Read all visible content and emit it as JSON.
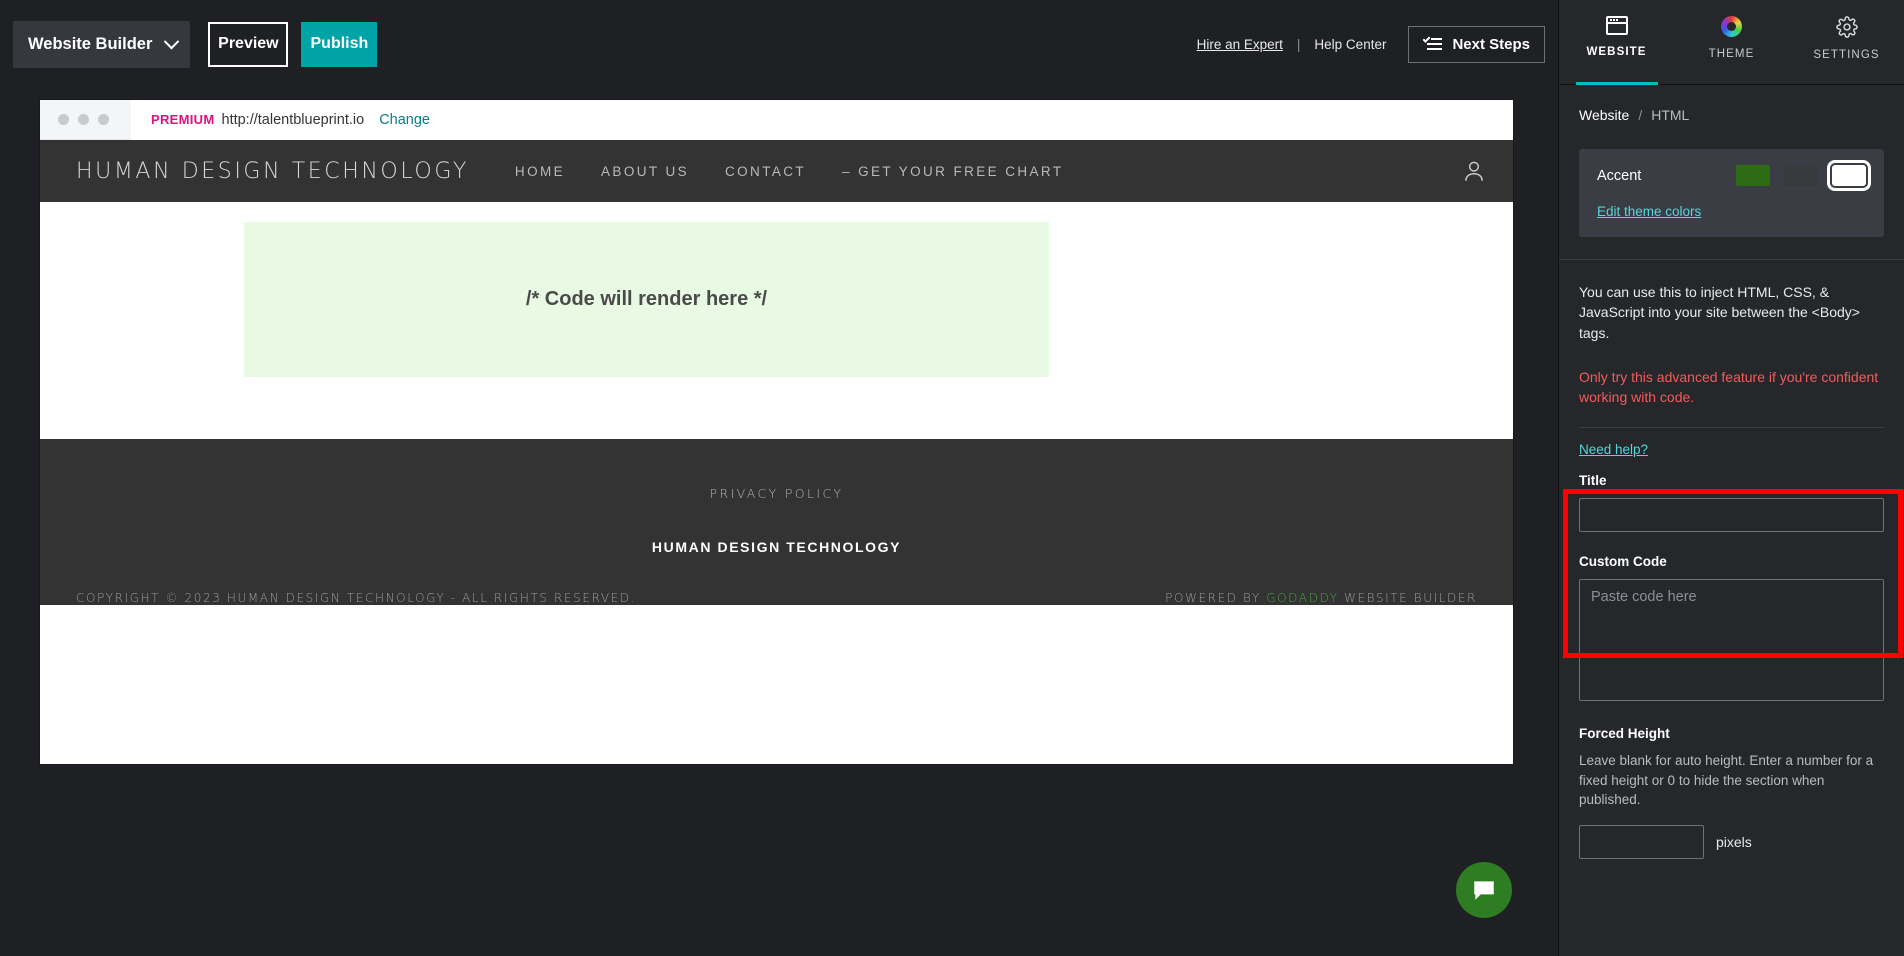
{
  "toolbar": {
    "builder_label": "Website Builder",
    "preview_label": "Preview",
    "publish_label": "Publish",
    "hire_expert_label": "Hire an Expert",
    "separator": "|",
    "help_center_label": "Help Center",
    "next_steps_label": "Next Steps"
  },
  "browser": {
    "premium_tag": "PREMIUM",
    "url": "http://talentblueprint.io",
    "change_label": "Change"
  },
  "site": {
    "logo": "HUMAN DESIGN TECHNOLOGY",
    "nav": [
      {
        "label": "HOME"
      },
      {
        "label": "ABOUT US"
      },
      {
        "label": "CONTACT"
      },
      {
        "label": "– GET YOUR FREE CHART"
      }
    ],
    "code_placeholder": "/* Code will render here */",
    "footer": {
      "privacy": "PRIVACY POLICY",
      "brand": "HUMAN DESIGN TECHNOLOGY",
      "copyright": "COPYRIGHT © 2023 HUMAN DESIGN TECHNOLOGY - ALL RIGHTS RESERVED.",
      "powered_prefix": "POWERED BY",
      "powered_brand": "GODADDY",
      "powered_suffix": "WEBSITE BUILDER"
    }
  },
  "sidebar": {
    "tabs": [
      {
        "label": "WEBSITE",
        "icon": "window-icon",
        "active": true
      },
      {
        "label": "THEME",
        "icon": "color-wheel-icon",
        "active": false
      },
      {
        "label": "SETTINGS",
        "icon": "gear-icon",
        "active": false
      }
    ],
    "breadcrumb": {
      "root": "Website",
      "separator": "/",
      "current": "HTML"
    },
    "accent": {
      "label": "Accent",
      "swatches": [
        "#2d6b14",
        "#383a3d",
        "#ffffff"
      ],
      "selected_index": 2,
      "edit_link": "Edit theme colors"
    },
    "info_text": "You can use this to inject HTML, CSS, & JavaScript into your site between the <Body> tags.",
    "warning_text": "Only try this advanced feature if you're confident working with code.",
    "warning_color": "#f35b5b",
    "need_help_label": "Need help?",
    "title_field": {
      "label": "Title",
      "value": "",
      "placeholder": ""
    },
    "custom_code_field": {
      "label": "Custom Code",
      "value": "",
      "placeholder": "Paste code here"
    },
    "forced_height": {
      "label": "Forced Height",
      "description": "Leave blank for auto height. Enter a number for a fixed height or 0 to hide the section when published.",
      "value": "",
      "unit": "pixels"
    },
    "highlight_color": "#ff0000"
  }
}
